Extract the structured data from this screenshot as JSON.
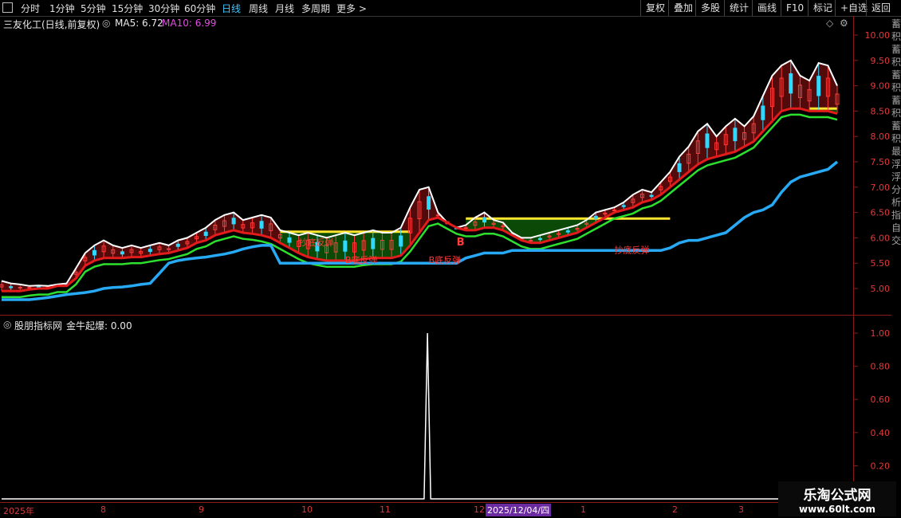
{
  "toolbar": {
    "items": [
      "分时",
      "1分钟",
      "5分钟",
      "15分钟",
      "30分钟",
      "60分钟",
      "日线",
      "周线",
      "月线",
      "多周期",
      "更多 >"
    ],
    "active_index": 6,
    "right_buttons": [
      "复权",
      "叠加",
      "多股",
      "统计",
      "画线",
      "F10",
      "标记",
      "+自选",
      "返回"
    ]
  },
  "main_chart": {
    "title": "三友化工(日线,前复权)",
    "ma5_label": "MA5: 6.72",
    "ma10_label": "MA10: 6.99",
    "y_ticks": [
      "10.00",
      "9.50",
      "9.00",
      "8.50",
      "8.00",
      "7.50",
      "7.00",
      "6.50",
      "6.00",
      "5.50",
      "5.00"
    ],
    "annotations": [
      "抄底反弹",
      "B底反弹",
      "B底反弹",
      "B",
      "抄底反弹"
    ],
    "signal_marker": "B"
  },
  "indicator": {
    "title": "股朋指标网",
    "series_label": "金牛起爆: 0.00",
    "y_ticks": [
      "1.00",
      "0.80",
      "0.60",
      "0.40",
      "0.20"
    ]
  },
  "date_axis": {
    "labels": [
      "2025年",
      "8",
      "9",
      "10",
      "11",
      "12",
      "1",
      "2",
      "3"
    ],
    "highlight": "2025/12/04/四"
  },
  "watermark": {
    "line1": "乐淘公式网",
    "line2": "www.60lt.com"
  },
  "side_panel_text": "蓄积蓄积蓄积蓄积蓄积最浮浮分析指自交",
  "colors": {
    "up": "#ff3b3b",
    "down": "#2fd8ff",
    "red_line": "#e31b1b",
    "green_line": "#2ee02e",
    "blue_line": "#27a9f5",
    "yellow": "#ffe62e",
    "fill_green": "#0b4a06",
    "fill_red": "#5b0b0b",
    "fill_purple": "#3a1aa0",
    "ma10": "#e04fe0"
  },
  "chart_data": {
    "type": "line",
    "indicator_series": {
      "name": "金牛起爆",
      "values": [
        0,
        0,
        0,
        0,
        0,
        0,
        0,
        0,
        0,
        0,
        0,
        0,
        0,
        0,
        0,
        0,
        0,
        0,
        0,
        0,
        0,
        0,
        0,
        0,
        0,
        0,
        0,
        0,
        0,
        0,
        0,
        0,
        0,
        0,
        0,
        0,
        0,
        0,
        0,
        0,
        0,
        0,
        0,
        0,
        0,
        0,
        0,
        0,
        0,
        0,
        0,
        0,
        0,
        0,
        0,
        0,
        0,
        0,
        0,
        0,
        0,
        0,
        0,
        0,
        0,
        0,
        0,
        0,
        0,
        0,
        0,
        0,
        0,
        0,
        0,
        0,
        0,
        0,
        0,
        0,
        0,
        0,
        0,
        0,
        0,
        0,
        0,
        0,
        0,
        0,
        0,
        0,
        0,
        0,
        0,
        0,
        0,
        0,
        0,
        0,
        0,
        0,
        0,
        0,
        0,
        0,
        0,
        0,
        0,
        0,
        0,
        0,
        0,
        0,
        0,
        0,
        0,
        0,
        0,
        0,
        0,
        0,
        0,
        0,
        0,
        0,
        0,
        0,
        0,
        0,
        1,
        0,
        0,
        0,
        0,
        0,
        0,
        0,
        0,
        0,
        0,
        0,
        0,
        0,
        0,
        0,
        0,
        0,
        0,
        0,
        0,
        0,
        0,
        0,
        0,
        0,
        0,
        0,
        0,
        0,
        0,
        0,
        0,
        0,
        0,
        0,
        0,
        0,
        0,
        0,
        0,
        0,
        0,
        0,
        0,
        0,
        0,
        0,
        0,
        0,
        0,
        0,
        0,
        0,
        0,
        0,
        0,
        0,
        0,
        0,
        0,
        0,
        0,
        0,
        0,
        0,
        0,
        0,
        0,
        0,
        0,
        0,
        0,
        0,
        0,
        0,
        0,
        0,
        0,
        0,
        0,
        0,
        0,
        0,
        0,
        0,
        0,
        0,
        0,
        0,
        0,
        0,
        0,
        0,
        0,
        0,
        0,
        0,
        0,
        0,
        0,
        0,
        0,
        0,
        0,
        0,
        0,
        0,
        0,
        0,
        0,
        0,
        0,
        0,
        0,
        0,
        0,
        0,
        0,
        0,
        0,
        0,
        0,
        0,
        0,
        0,
        0,
        0,
        0,
        0
      ]
    },
    "price_upper": [
      5.15,
      5.1,
      5.08,
      5.05,
      5.06,
      5.05,
      5.08,
      5.1,
      5.4,
      5.7,
      5.85,
      5.95,
      5.85,
      5.8,
      5.85,
      5.8,
      5.85,
      5.9,
      5.85,
      5.95,
      6.0,
      6.1,
      6.2,
      6.35,
      6.45,
      6.5,
      6.35,
      6.4,
      6.45,
      6.4,
      6.15,
      6.1,
      6.05,
      6.1,
      6.05,
      6.0,
      6.05,
      6.1,
      6.05,
      6.1,
      6.15,
      6.1,
      6.1,
      6.2,
      6.6,
      6.95,
      7.0,
      6.5,
      6.3,
      6.2,
      6.25,
      6.4,
      6.5,
      6.35,
      6.3,
      6.1,
      6.0,
      6.0,
      6.05,
      6.1,
      6.15,
      6.2,
      6.25,
      6.35,
      6.5,
      6.55,
      6.6,
      6.7,
      6.85,
      6.95,
      6.9,
      7.1,
      7.3,
      7.6,
      7.8,
      8.1,
      8.25,
      8.0,
      8.2,
      8.35,
      8.2,
      8.4,
      8.8,
      9.2,
      9.4,
      9.5,
      9.2,
      9.1,
      9.45,
      9.4,
      9.0
    ],
    "price_red_line": [
      4.95,
      4.95,
      4.95,
      4.98,
      5.0,
      5.0,
      5.05,
      5.05,
      5.2,
      5.45,
      5.55,
      5.6,
      5.6,
      5.6,
      5.62,
      5.62,
      5.65,
      5.68,
      5.7,
      5.75,
      5.8,
      5.9,
      5.95,
      6.05,
      6.1,
      6.15,
      6.1,
      6.08,
      6.05,
      6.0,
      5.9,
      5.8,
      5.7,
      5.62,
      5.58,
      5.55,
      5.55,
      5.55,
      5.55,
      5.58,
      5.6,
      5.6,
      5.6,
      5.65,
      5.85,
      6.1,
      6.35,
      6.4,
      6.3,
      6.2,
      6.15,
      6.15,
      6.2,
      6.2,
      6.15,
      6.05,
      5.95,
      5.9,
      5.9,
      5.95,
      6.0,
      6.05,
      6.1,
      6.2,
      6.3,
      6.4,
      6.5,
      6.55,
      6.6,
      6.7,
      6.75,
      6.85,
      7.0,
      7.15,
      7.3,
      7.45,
      7.55,
      7.6,
      7.65,
      7.7,
      7.8,
      7.9,
      8.1,
      8.3,
      8.5,
      8.55,
      8.55,
      8.5,
      8.5,
      8.5,
      8.45
    ],
    "price_blue_line": [
      4.78,
      4.78,
      4.78,
      4.78,
      4.8,
      4.82,
      4.85,
      4.88,
      4.9,
      4.92,
      4.95,
      5.0,
      5.02,
      5.03,
      5.05,
      5.08,
      5.1,
      5.3,
      5.5,
      5.55,
      5.58,
      5.6,
      5.62,
      5.65,
      5.68,
      5.72,
      5.78,
      5.82,
      5.85,
      5.85,
      5.5,
      5.5,
      5.5,
      5.5,
      5.5,
      5.5,
      5.5,
      5.5,
      5.5,
      5.5,
      5.5,
      5.5,
      5.5,
      5.5,
      5.5,
      5.5,
      5.5,
      5.5,
      5.5,
      5.5,
      5.6,
      5.65,
      5.7,
      5.7,
      5.7,
      5.75,
      5.75,
      5.75,
      5.75,
      5.75,
      5.75,
      5.75,
      5.75,
      5.75,
      5.75,
      5.75,
      5.75,
      5.75,
      5.75,
      5.75,
      5.75,
      5.75,
      5.8,
      5.9,
      5.95,
      5.95,
      6.0,
      6.05,
      6.1,
      6.25,
      6.4,
      6.5,
      6.55,
      6.65,
      6.9,
      7.1,
      7.2,
      7.25,
      7.3,
      7.35,
      7.5
    ]
  }
}
